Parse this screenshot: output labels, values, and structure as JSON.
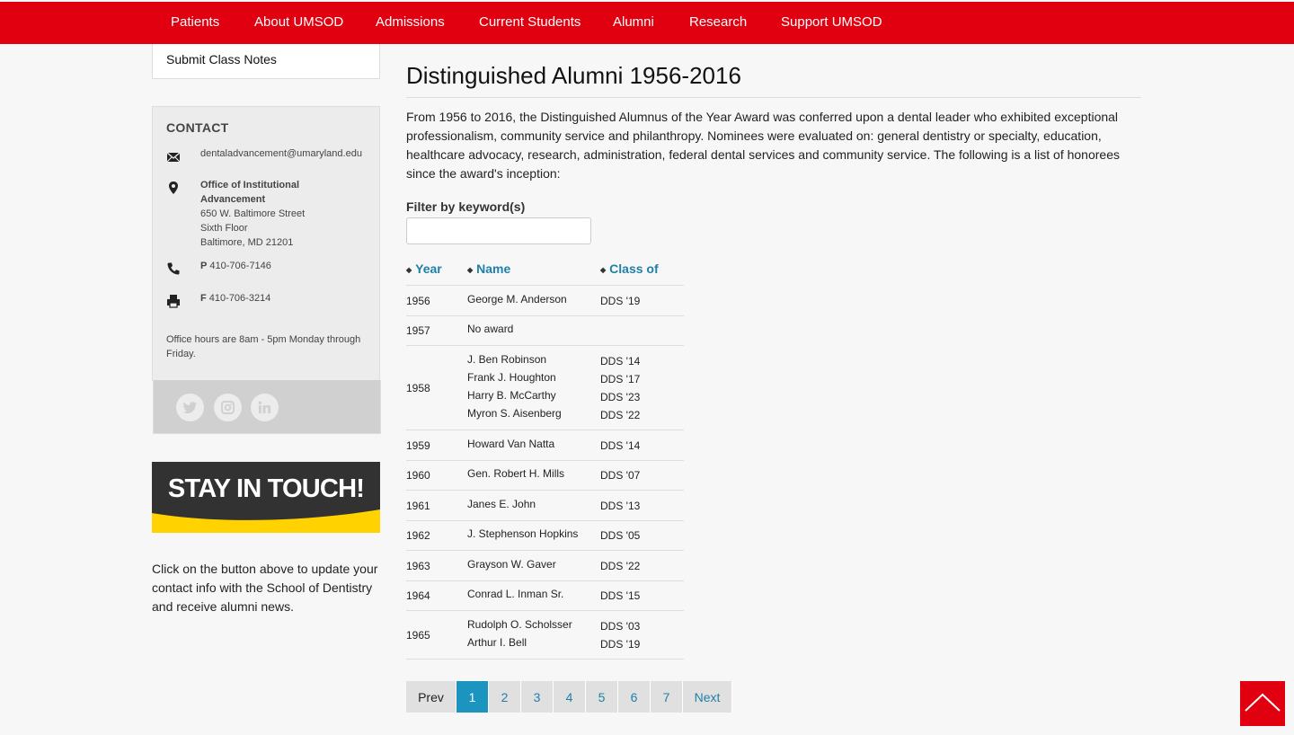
{
  "nav": {
    "items": [
      "Patients",
      "About UMSOD",
      "Admissions",
      "Current Students",
      "Alumni",
      "Research",
      "Support UMSOD"
    ]
  },
  "sidebar": {
    "class_notes": "Submit Class Notes",
    "contact": {
      "heading": "CONTACT",
      "email": "dentaladvancement@umaryland.edu",
      "office_line1": "Office of Institutional",
      "office_line2": "Advancement",
      "address1": "650 W. Baltimore Street",
      "address2": "Sixth Floor",
      "address3": "Baltimore, MD 21201",
      "phone_prefix": "P",
      "phone": "410-706-7146",
      "fax_prefix": "F",
      "fax": "410-706-3214",
      "hours": "Office hours are 8am - 5pm Monday through Friday."
    },
    "social": [
      "twitter-icon",
      "instagram-icon",
      "linkedin-icon"
    ],
    "banner_text": "STAY IN TOUCH!",
    "note": "Click on the button above to update your contact info with the School of Dentistry and receive alumni news."
  },
  "main": {
    "title": "Distinguished Alumni 1956-2016",
    "intro": "From 1956 to 2016, the Distinguished Alumnus of the Year Award was conferred upon a dental leader who exhibited exceptional professionalism, community service and philanthropy. Nominees were evaluated on: general dentistry or specialty, education, healthcare advocacy, research, administration, federal dental services and community service. The following is a list of honorees since the award's inception:",
    "filter_label": "Filter by keyword(s)",
    "filter_value": "",
    "columns": [
      "Year",
      "Name",
      "Class of"
    ],
    "rows": [
      {
        "year": "1956",
        "names": [
          "George M. Anderson"
        ],
        "classes": [
          "DDS '19"
        ]
      },
      {
        "year": "1957",
        "names": [
          "No award"
        ],
        "classes": []
      },
      {
        "year": "1958",
        "names": [
          "J. Ben Robinson",
          "Frank J. Houghton",
          "Harry B. McCarthy",
          "Myron S. Aisenberg"
        ],
        "classes": [
          "DDS '14",
          "DDS '17",
          "DDS '23",
          "DDS '22"
        ]
      },
      {
        "year": "1959",
        "names": [
          "Howard Van Natta"
        ],
        "classes": [
          "DDS '14"
        ]
      },
      {
        "year": "1960",
        "names": [
          "Gen. Robert H. Mills"
        ],
        "classes": [
          "DDS '07"
        ]
      },
      {
        "year": "1961",
        "names": [
          "Janes E. John"
        ],
        "classes": [
          "DDS '13"
        ]
      },
      {
        "year": "1962",
        "names": [
          "J. Stephenson Hopkins"
        ],
        "classes": [
          "DDS '05"
        ]
      },
      {
        "year": "1963",
        "names": [
          "Grayson W. Gaver"
        ],
        "classes": [
          "DDS '22"
        ]
      },
      {
        "year": "1964",
        "names": [
          "Conrad L. Inman Sr."
        ],
        "classes": [
          "DDS '15"
        ]
      },
      {
        "year": "1965",
        "names": [
          "Rudolph O. Scholsser",
          "Arthur I. Bell"
        ],
        "classes": [
          "DDS '03",
          "DDS '19"
        ]
      }
    ],
    "pagination": {
      "prev": "Prev",
      "pages": [
        "1",
        "2",
        "3",
        "4",
        "5",
        "6",
        "7"
      ],
      "current": "1",
      "next": "Next"
    }
  },
  "colors": {
    "brand_red": "#e1000f",
    "link_blue": "#1f7fa8",
    "active_page": "#1b94c0",
    "banner_yellow": "#ffd200"
  },
  "back_to_top_icon": "chevron-up-icon"
}
